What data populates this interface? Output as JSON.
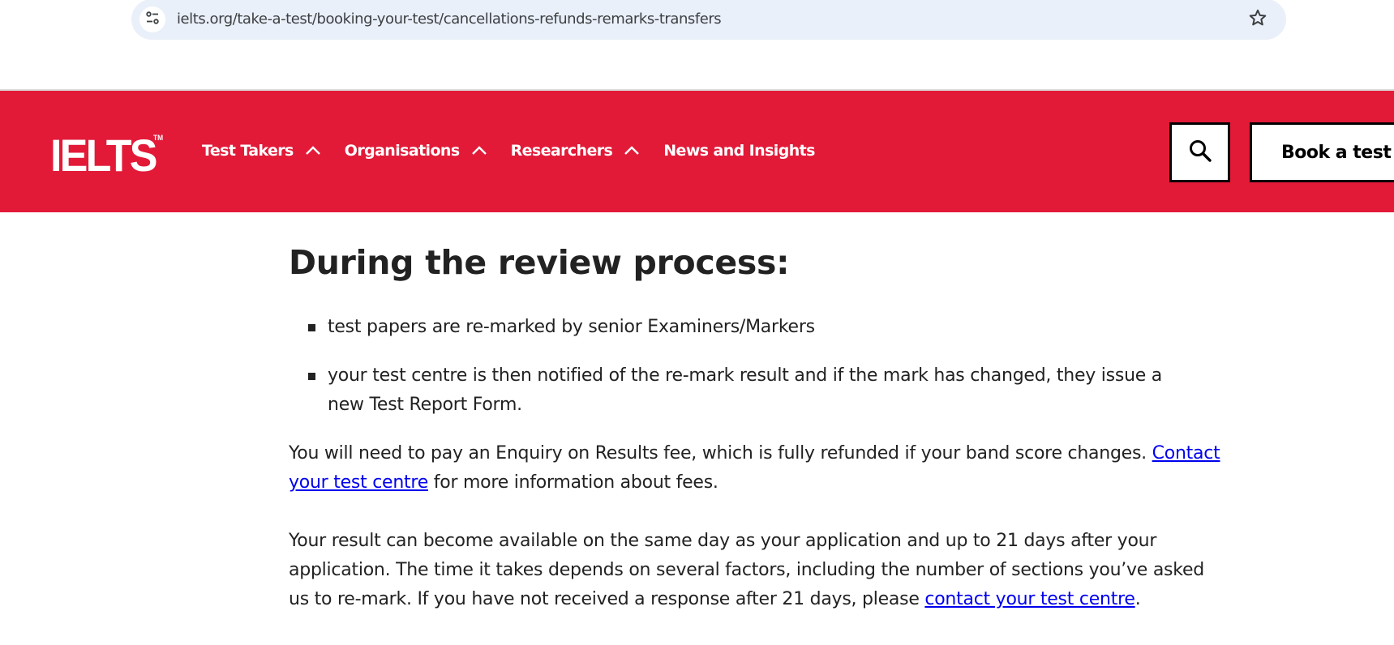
{
  "browser": {
    "url": "ielts.org/take-a-test/booking-your-test/cancellations-refunds-remarks-transfers",
    "site_info_icon": "tune-icon",
    "bookmark_icon": "star-outline-icon"
  },
  "header": {
    "brand_color": "#e21a38",
    "logo": "IELTS",
    "logo_tm": "TM",
    "nav": [
      {
        "label": "Test Takers",
        "has_dropdown": true,
        "chevron": "chevron-up-icon"
      },
      {
        "label": "Organisations",
        "has_dropdown": true,
        "chevron": "chevron-up-icon"
      },
      {
        "label": "Researchers",
        "has_dropdown": true,
        "chevron": "chevron-up-icon"
      },
      {
        "label": "News and Insights",
        "has_dropdown": false
      }
    ],
    "search_icon": "search-icon",
    "book_label": "Book a test"
  },
  "content": {
    "heading": "During the review process:",
    "bullets": [
      "test papers are re-marked by senior Examiners/Markers",
      "your test centre is then notified of the re-mark result and if the mark has changed, they issue a new Test Report Form."
    ],
    "para1": {
      "text_before": "You will need to pay an Enquiry on Results fee, which is fully refunded if your band score changes. ",
      "link": "Contact your test centre",
      "text_after": " for more information about fees."
    },
    "para2": {
      "text_before": "Your result can become available on the same day as your application and up to 21 days after your application. The time it takes depends on several factors, including the number of sections you’ve asked us to re-mark. If you have not received a response after 21 days, please ",
      "link": "contact your test centre",
      "text_after": "."
    },
    "link_color": "#0000ee"
  }
}
